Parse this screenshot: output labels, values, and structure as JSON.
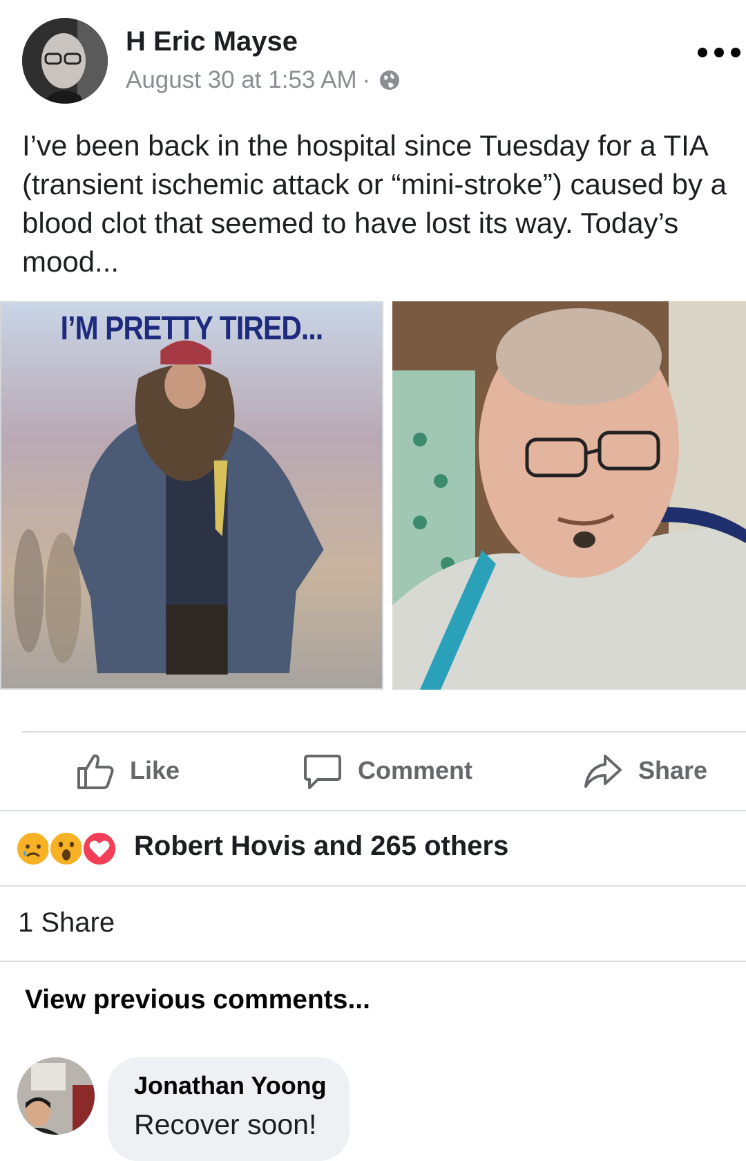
{
  "post": {
    "author": "H Eric Mayse",
    "timestamp": "August 30 at 1:53 AM",
    "separator": "·",
    "privacy_icon": "globe-icon",
    "more_icon": "more-options-icon",
    "text": "I’ve been back in the hospital since Tuesday for a TIA (transient ischemic attack or “mini-stroke”) caused by a blood clot that seemed to have lost its way. Today’s mood...",
    "meme_caption": "I’M PRETTY TIRED..."
  },
  "actions": {
    "like": "Like",
    "comment": "Comment",
    "share": "Share"
  },
  "reactions": {
    "icons": [
      "sad-reaction-icon",
      "wow-reaction-icon",
      "love-reaction-icon"
    ],
    "summary": "Robert Hovis and 265 others"
  },
  "shares": {
    "label": "1 Share"
  },
  "comments": {
    "view_previous": "View previous comments...",
    "items": [
      {
        "author": "Jonathan Yoong",
        "text": "Recover soon!"
      }
    ]
  },
  "colors": {
    "text_primary": "#1c1e21",
    "text_secondary": "#65676b",
    "bubble_bg": "#eef0f3",
    "love_red": "#f33e58",
    "reaction_yellow": "#f7b125"
  }
}
